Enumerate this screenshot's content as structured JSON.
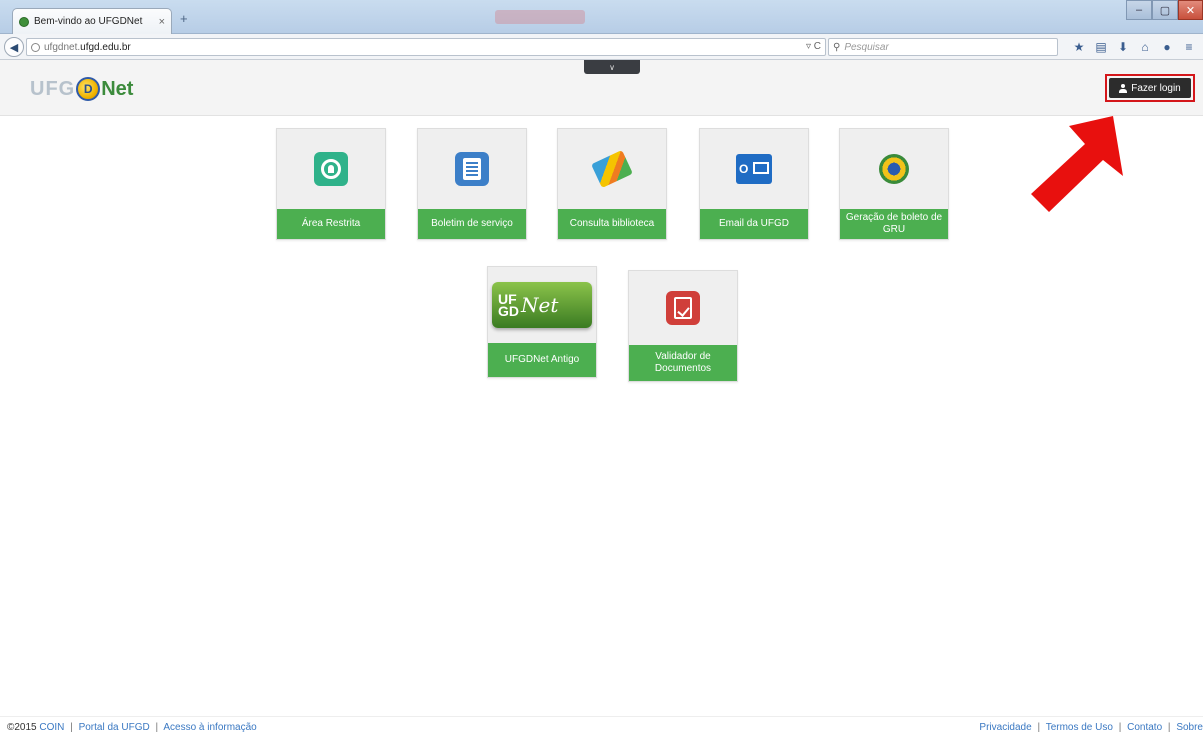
{
  "browser": {
    "tab_title": "Bem-vindo ao UFGDNet",
    "tab_close": "×",
    "new_tab": "+",
    "url_prefix": "ufgdnet.",
    "url_domain": "ufgd.edu.br",
    "reload": "▿ C",
    "search_placeholder": "Pesquisar",
    "window_controls": {
      "minimize": "–",
      "maximize": "▢",
      "close": "✕"
    }
  },
  "header": {
    "logo": {
      "uf": "UFG",
      "d": "D",
      "net": "Net"
    },
    "collapse": "∨",
    "login_label": "Fazer login"
  },
  "tiles": [
    {
      "label": "Área Restrita"
    },
    {
      "label": "Boletim de serviço"
    },
    {
      "label": "Consulta biblioteca"
    },
    {
      "label": "Email da UFGD"
    },
    {
      "label": "Geração de boleto de GRU"
    },
    {
      "label": "UFGDNet Antigo",
      "logo_top": "UF",
      "logo_bottom": "GD",
      "logo_net": "Net"
    },
    {
      "label": "Validador de Documentos"
    }
  ],
  "footer": {
    "copyright": "©2015",
    "links_left": [
      "COIN",
      "Portal da UFGD",
      "Acesso à informação"
    ],
    "links_right": [
      "Privacidade",
      "Termos de Uso",
      "Contato",
      "Sobre"
    ],
    "separator": "|"
  },
  "colors": {
    "tile_green": "#4caf50",
    "login_bg": "#2c2c2c",
    "highlight_red": "#d4161a",
    "link_blue": "#3a78c2"
  }
}
